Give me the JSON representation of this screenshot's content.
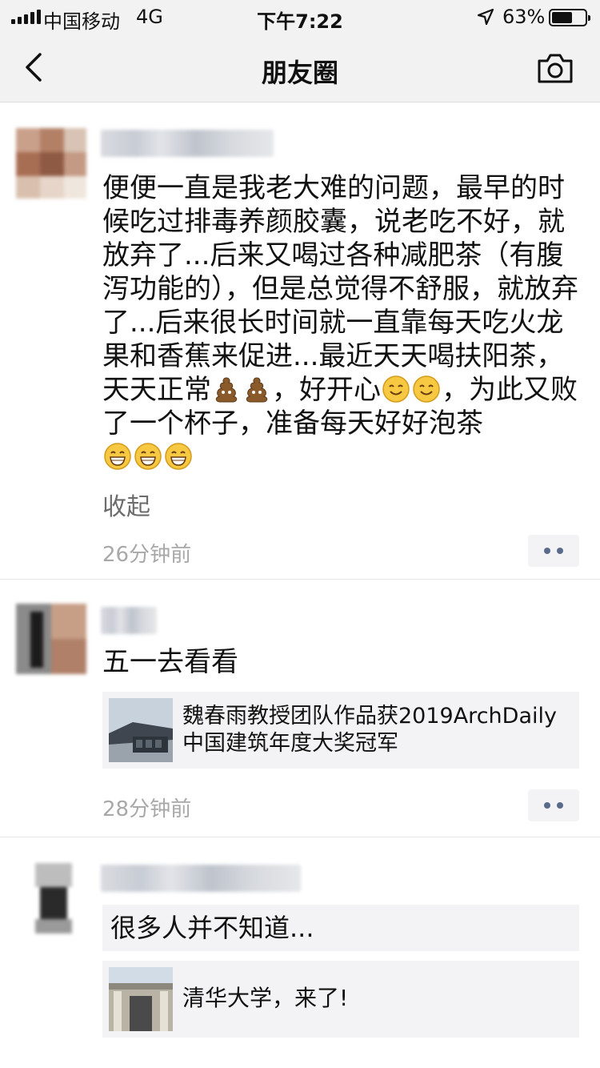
{
  "status_bar": {
    "carrier": "中国移动",
    "network": "4G",
    "time": "下午7:22",
    "battery_percent": "63%",
    "battery_level": 0.63
  },
  "nav": {
    "title": "朋友圈",
    "back_icon": "chevron-left-icon",
    "camera_icon": "camera-icon"
  },
  "posts": [
    {
      "text_parts": [
        "便便一直是我老大难的问题，最早的时候吃过排毒养颜胶囊，说老吃不好，就放弃了...后来又喝过各种减肥茶（有腹泻功能的），但是总觉得不舒服，就放弃了...后来很长时间就一直靠每天吃火龙果和香蕉来促进...最近天天喝扶阳茶，天天正常",
        "，好开心",
        "，为此又败了一个杯子，准备每天好好泡茶"
      ],
      "emojis": [
        "poop",
        "poop",
        "smile",
        "smile",
        "grin",
        "grin",
        "grin"
      ],
      "fold_label": "收起",
      "time": "26分钟前"
    },
    {
      "text": "五一去看看",
      "link_title": "魏春雨教授团队作品获2019ArchDaily中国建筑年度大奖冠军",
      "time": "28分钟前"
    },
    {
      "text": "很多人并不知道...",
      "link_title": "清华大学，来了!"
    }
  ]
}
